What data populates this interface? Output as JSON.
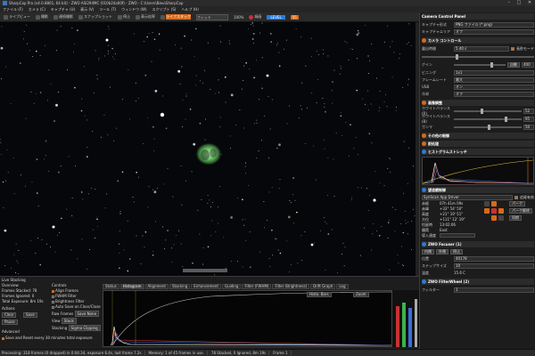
{
  "window": {
    "title": "SharpCap Pro (v4.0.8801, 64 bit) - ZWO ASI294MC (010b24a00f) - ZWO - C:\\Users\\Bieu\\SharpCap",
    "minimize": "–",
    "maximize": "□",
    "close": "✕"
  },
  "menu": [
    "ファイル (F)",
    "カメラ (C)",
    "キャプチャ (U)",
    "表示 (V)",
    "ツール (T)",
    "ウィンドウ (W)",
    "スクリプト (S)",
    "ヘルプ (H)"
  ],
  "toolbar": {
    "items": [
      "ライブビュー",
      "撮影",
      "連続撮影",
      "スナップショット",
      "停止",
      "表示倍率"
    ],
    "zoom_label": "ズーム",
    "zoom_value": "フィット",
    "live_stack": "ライブスタック",
    "fps": "100%",
    "record": "録画",
    "blue_button": "LEVEL",
    "badge": "55"
  },
  "camera_panel": {
    "title": "Camera Control Panel",
    "capture_format": {
      "label": "キャプチャ形式",
      "value": "PNG ファイル (*.png)"
    },
    "region": {
      "label": "キャプチャエリア",
      "value": "オフ"
    },
    "camera_controls_title": "カメラ コントロール",
    "exposure": {
      "label": "露出時間",
      "value": "5.40 s",
      "check": "長秒モード"
    },
    "gain": {
      "label": "ゲイン",
      "value": "400",
      "auto": "自動"
    },
    "binning": {
      "label": "ビニング",
      "value": "1x1"
    },
    "frame_rate": {
      "label": "フレームレート",
      "value": "最大"
    },
    "usb": {
      "label": "USB",
      "value": "オン"
    },
    "cooler": {
      "label": "冷却",
      "value": "オフ"
    },
    "image_title": "画像調整",
    "white_balance_r": {
      "label": "ホワイトバランス (R)",
      "value": "52"
    },
    "white_balance_b": {
      "label": "ホワイトバランス (B)",
      "value": "95"
    },
    "gamma": {
      "label": "ガンマ",
      "value": "50"
    },
    "other_controls": "その他の制御",
    "preprocessing": "前処理",
    "histogram_title": "ヒストグラムストレッチ",
    "mount_title": "望遠鏡制御",
    "mount": {
      "name": "SynScan App Driver",
      "tracking": "追尾有効",
      "ra_label": "赤経",
      "ra": "07h 41m 09s",
      "dec_label": "赤緯",
      "dec": "+33° 54' 50\"",
      "alt_label": "高度",
      "alt": "+21° 19' 51\"",
      "az_label": "方位",
      "az": "+111° 12' 19\"",
      "lst_label": "恒星時",
      "lst": "13:02:06",
      "pier_label": "鏡筒",
      "pier": "East",
      "slew_label": "導入速度",
      "park": "パーク",
      "unpark": "パーク解除",
      "sync": "同期"
    },
    "focuser_title": "ZWO Focuser (1)",
    "focuser": {
      "move_in": "内側",
      "move_out": "外側",
      "position_label": "位置",
      "position": "40178",
      "step_label": "ステップサイズ",
      "step": "10",
      "temp_label": "温度",
      "temp": "15.6 C",
      "stop": "停止"
    },
    "filterwheel_title": "ZWO FilterWheel (2)",
    "filterwheel": {
      "label": "フィルター",
      "value": "1"
    }
  },
  "live_stack": {
    "title": "Live Stacking",
    "overview_label": "Overview",
    "frames_stacked": "Frames Stacked: 78",
    "frames_ignored": "Frames Ignored: 0",
    "total_exposure": "Total Exposure: 8m 19s",
    "actions": "Actions",
    "clear": "Clear",
    "save": "Save",
    "pause": "Pause",
    "controls": "Controls",
    "align_frames": "Align Frames",
    "fwhm_filter": "FWHM Filter",
    "brightness_filter": "Brightness Filter",
    "auto_save": "Auto Save on Clear/Close",
    "raw_frames_label": "Raw Frames",
    "raw_frames_value": "Save None",
    "view_label": "View",
    "view_value": "Stack",
    "stacking_label": "Stacking",
    "stacking_value": "Sigma Clipping",
    "advanced": "Advanced",
    "save_every": "Save and Reset every",
    "save_every_value": "30",
    "save_every_unit": "minutes total exposure",
    "tabs": [
      "Status",
      "Histogram",
      "Alignment",
      "Stacking",
      "Enhancement",
      "Guiding",
      "Filter (FWHM)",
      "Filter (Brightness)",
      "Drift Graph",
      "Log"
    ],
    "hist_options": "Histo. Bars",
    "hist_zoom": "Zoom"
  },
  "status": {
    "segments": [
      "Processing: 318 frames (0 dropped) in 0:04:34, exposure 6.4s, last frame 7.2s",
      "Memory: 1 of 45 frames in use.",
      "78 Stacked, 0 Ignored, 8m 19s",
      "Frame 1"
    ]
  }
}
